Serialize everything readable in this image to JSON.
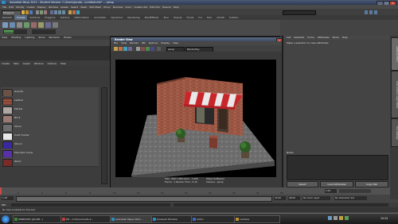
{
  "window": {
    "title": "Autodesk Maya 2012 - Student Version: C:\\Users\\jacob\\...\\untitled.mb* --- persp",
    "min_label": "_",
    "max_label": "□",
    "close_label": "X"
  },
  "menubar": [
    "File",
    "Edit",
    "Modify",
    "Create",
    "Display",
    "Window",
    "Assets",
    "Select",
    "Mesh",
    "Edit Mesh",
    "Proxy",
    "Normals",
    "Color",
    "Create UVs",
    "Edit UVs",
    "Muscle",
    "Help"
  ],
  "statusline": {
    "mode": "Polygons"
  },
  "shelf_tabs": [
    "General",
    "Curves",
    "Surfaces",
    "Polygons",
    "Subdivs",
    "Deformation",
    "Animation",
    "Dynamics",
    "Rendering",
    "PaintEffects",
    "Toon",
    "Muscle",
    "Fluids",
    "Fur",
    "Hair",
    "nCloth",
    "Custom"
  ],
  "shelf_active": "Curves",
  "leftpanel": {
    "menu": [
      "View",
      "Shading",
      "Lighting",
      "Show",
      "Renderer",
      "Panels"
    ],
    "menu2": [
      "Create",
      "Tabs",
      "Graph",
      "Window",
      "Options",
      "Help"
    ],
    "swatches": [
      {
        "label": "Granite",
        "color": "#6a5246"
      },
      {
        "label": "Leather",
        "color": "#8a4a3a"
      },
      {
        "label": "Marble",
        "color": "#b0a6a2"
      },
      {
        "label": "Brick",
        "color": "#9a7a72"
      },
      {
        "label": "Stone",
        "color": "#6e6e6e"
      },
      {
        "label": "Solid Fractal",
        "color": "#e8e8e8"
      },
      {
        "label": "Stucco",
        "color": "#3a28a0"
      },
      {
        "label": "Mountain Snow",
        "color": "#5a30a8"
      },
      {
        "label": "Wood",
        "color": "#7a2a28"
      }
    ]
  },
  "renderview": {
    "title": "Render View",
    "menu": [
      "File",
      "View",
      "Render",
      "IPR",
      "Options",
      "Display",
      "Help"
    ],
    "camera_label": "persp",
    "renderer": "Mental Ray",
    "info_line1": "Size : 640 x 480 zoom : 1.000",
    "info_line2": "Frame : 1   Render Time : 0:10",
    "info_renderer": "(Maya Software)",
    "info_camera": "Camera : persp"
  },
  "attr": {
    "menu": [
      "List",
      "Selected",
      "Focus",
      "Attributes",
      "Show",
      "Help"
    ],
    "message": "Make a selection to view attributes",
    "notes_label": "Notes",
    "select_btn": "Select",
    "load_btn": "Load Attributes",
    "copy_btn": "Copy Tab"
  },
  "side_tabs": [
    "Attribute Editor",
    "Channel Box / Layer Editor",
    "Tool Settings"
  ],
  "timeline": {
    "ticks": [
      "2",
      "4",
      "6",
      "8",
      "10",
      "12",
      "14",
      "16",
      "18",
      "20",
      "22",
      "24"
    ],
    "current": "1.00"
  },
  "range": {
    "start": "1.00",
    "end": "24.00",
    "anim_end": "48.00",
    "layer": "No Anim Layer",
    "char": "No Character Set"
  },
  "cmdline": {
    "lang": "MEL"
  },
  "helpline": {
    "text": "No help available for this tool"
  },
  "taskbar": [
    {
      "label": "WINDOWS (JACOB...)",
      "color": "#3a8a3a"
    },
    {
      "label": "HR - C:\\Documents a...",
      "color": "#c04040"
    },
    {
      "label": "Autodesk Maya 2012 ...",
      "color": "#2a8fbf"
    },
    {
      "label": "Unsaved Window",
      "color": "#2a8fbf"
    },
    {
      "label": "CUCU",
      "color": "#3a6ac0"
    },
    {
      "label": "Lumiere",
      "color": "#c09030"
    }
  ],
  "clock": "10:24"
}
